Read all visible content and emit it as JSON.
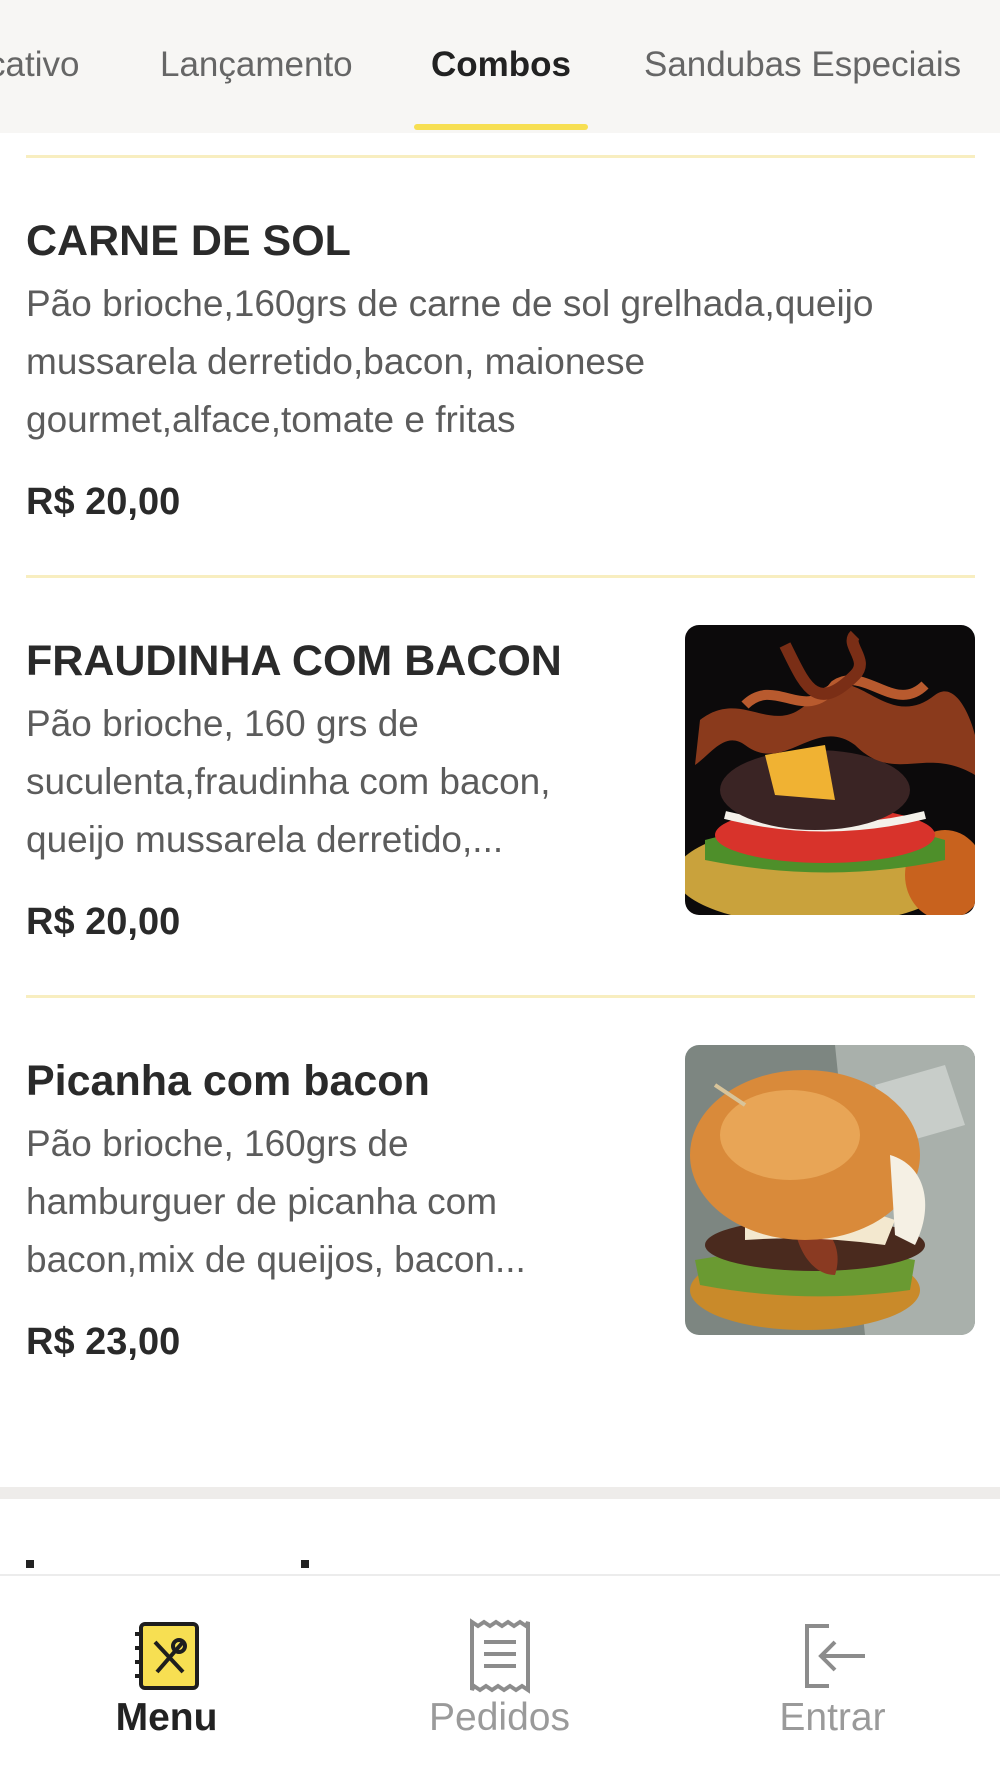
{
  "tabs": [
    {
      "label": "cativo"
    },
    {
      "label": "Lançamento"
    },
    {
      "label": "Combos",
      "active": true
    },
    {
      "label": "Sandubas Especiais"
    }
  ],
  "items": [
    {
      "name": "CARNE DE SOL",
      "desc_lines": [
        "Pão brioche,160grs de carne de sol grelhada,queijo",
        "mussarela derretido,bacon, maionese",
        "gourmet,alface,tomate e fritas"
      ],
      "price": "R$ 20,00"
    },
    {
      "name": "FRAUDINHA COM BACON",
      "desc_lines": [
        "Pão brioche, 160 grs de",
        "suculenta,fraudinha com bacon,",
        "queijo mussarela derretido,..."
      ],
      "price": "R$ 20,00",
      "image": "burger-bacon-photo"
    },
    {
      "name": "Picanha com bacon",
      "desc_lines": [
        "Pão brioche, 160grs de",
        "hamburguer de picanha com",
        "bacon,mix de queijos, bacon..."
      ],
      "price": "R$ 23,00",
      "image": "burger-picanha-photo"
    }
  ],
  "bottom_nav": [
    {
      "label": "Menu",
      "icon": "menu-book-icon",
      "active": true
    },
    {
      "label": "Pedidos",
      "icon": "receipt-icon"
    },
    {
      "label": "Entrar",
      "icon": "sign-in-icon"
    }
  ],
  "colors": {
    "accent": "#f7df52",
    "divider": "#f8eec0",
    "tab_bg": "#f7f6f4",
    "text_dark": "#2a2a2a",
    "text_muted": "#5c5c5c",
    "nav_inactive": "#9a9a9a"
  }
}
